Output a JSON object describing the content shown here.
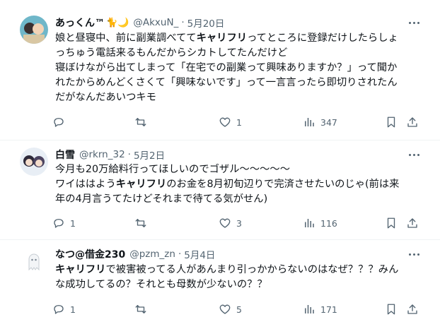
{
  "posts": [
    {
      "name": "あっくん™",
      "emoji": "🐈🌙",
      "handle": "@AkxuN_",
      "separator": "·",
      "date": "5月20日",
      "line1_pre": "娘と昼寝中、前に副業調べてて",
      "line1_bold": "キャリフリ",
      "line1_post": "ってところに登録だけしたらしょ",
      "line2": "っちゅう電話来るもんだからシカトしてたんだけど",
      "line3": "寝ぼけながら出てしまって「在宅での副業って興味ありますか？」って聞か",
      "line4": "れたからめんどくさくて「興味ないです」って一言言ったら即切りされたん",
      "line5": "だがなんだあいつキモ",
      "replies": "",
      "reposts": "",
      "likes": "1",
      "views": "347"
    },
    {
      "name": "白雪",
      "handle": "@rkrn_32",
      "separator": "·",
      "date": "5月2日",
      "line1": "今月も20万給料行ってほしいのでゴザル〜〜〜〜〜",
      "line2_pre": "ワイははよう",
      "line2_bold": "キャリフリ",
      "line2_post": "のお金を8月初旬辺りで完済させたいのじゃ(前は来",
      "line3": "年の4月言うてたけどそれまで待てる気がせん)",
      "replies": "1",
      "reposts": "",
      "likes": "3",
      "views": "116"
    },
    {
      "name": "なつ@借金230",
      "handle": "@pzm_zn",
      "separator": "·",
      "date": "5月4日",
      "line1_bold": "キャリフリ",
      "line1_post": "で被害被ってる人があんまり引っかからないのはなぜ？？？みん",
      "line2": "な成功してるの？それとも母数が少ないの？？",
      "replies": "1",
      "reposts": "",
      "likes": "5",
      "views": "171"
    }
  ],
  "icons": [
    "more-icon",
    "reply-icon",
    "repost-icon",
    "like-icon",
    "views-icon",
    "bookmark-icon",
    "share-icon"
  ],
  "colors": {
    "text": "#0f1419",
    "muted": "#536471",
    "divider": "#eff3f4"
  }
}
